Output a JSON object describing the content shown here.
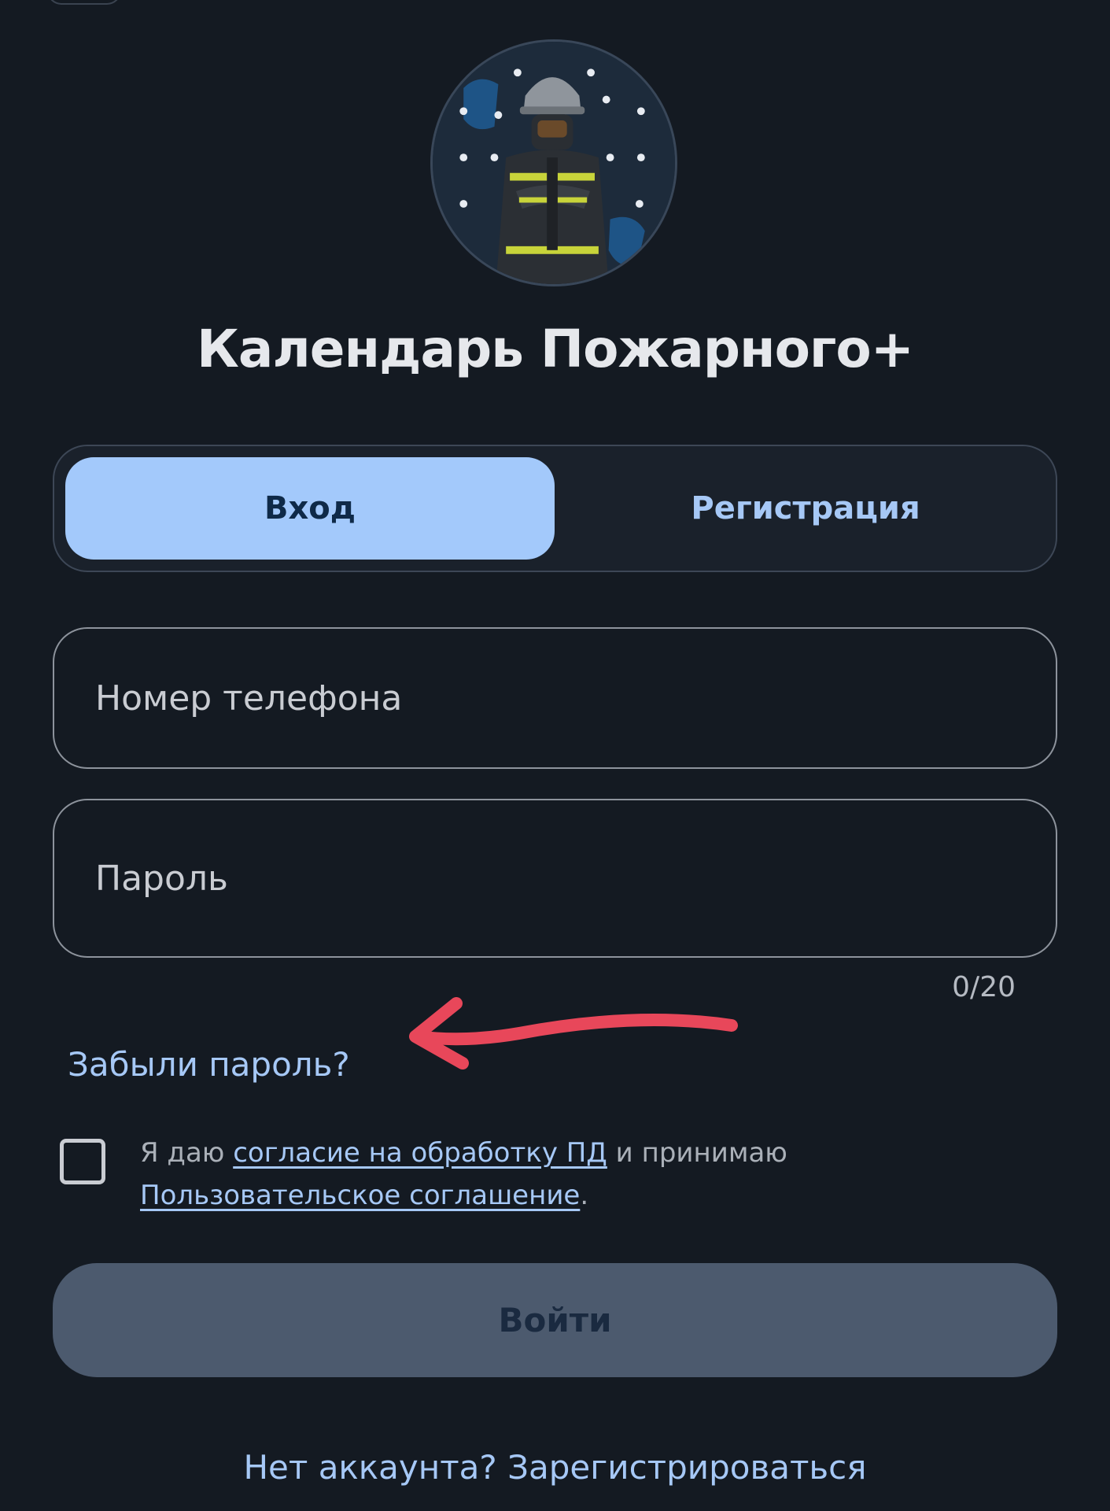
{
  "app": {
    "title": "Календарь Пожарного+"
  },
  "tabs": {
    "login_label": "Вход",
    "register_label": "Регистрация",
    "active": "login"
  },
  "form": {
    "phone_placeholder": "Номер телефона",
    "password_placeholder": "Пароль",
    "password_counter": "0/20",
    "forgot_password": "Забыли пароль?"
  },
  "consent": {
    "text_before": "Я даю ",
    "link_pd": "согласие на обработку ПД",
    "text_middle": " и принимаю ",
    "link_agreement": "Пользовательское соглашение",
    "text_after": ".",
    "checked": false
  },
  "submit": {
    "label": "Войти",
    "enabled": false
  },
  "footer": {
    "signup_prompt": "Нет аккаунта? Зарегистрироваться"
  },
  "annotation": {
    "arrow_color": "#e8475a"
  },
  "colors": {
    "background": "#141a22",
    "accent": "#a3c9fb",
    "link": "#a6c8f6",
    "button_disabled": "#4c5a6e"
  }
}
